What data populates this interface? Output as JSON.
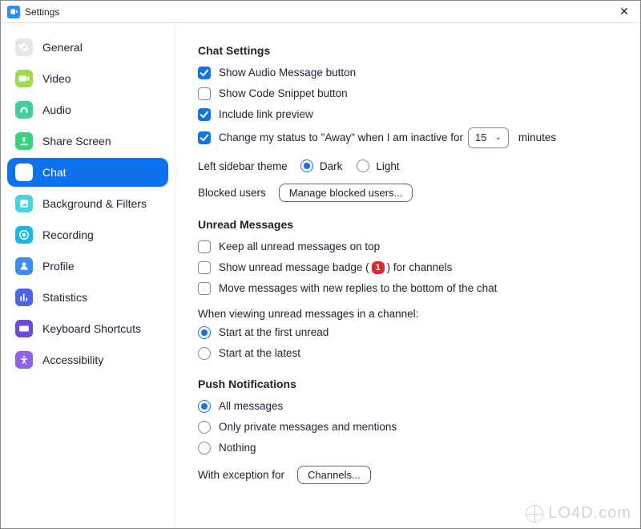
{
  "window": {
    "title": "Settings"
  },
  "sidebar": {
    "items": [
      {
        "label": "General",
        "color": "#E6E6E8",
        "icon": "gear",
        "active": false
      },
      {
        "label": "Video",
        "color": "#9BDB4D",
        "icon": "video",
        "active": false
      },
      {
        "label": "Audio",
        "color": "#3ED09C",
        "icon": "audio",
        "active": false
      },
      {
        "label": "Share Screen",
        "color": "#34D57A",
        "icon": "share",
        "active": false
      },
      {
        "label": "Chat",
        "color": "#0E72ED",
        "icon": "chat",
        "active": true
      },
      {
        "label": "Background & Filters",
        "color": "#48D1E0",
        "icon": "bgfilter",
        "active": false
      },
      {
        "label": "Recording",
        "color": "#18B7E6",
        "icon": "record",
        "active": false
      },
      {
        "label": "Profile",
        "color": "#3A8BF4",
        "icon": "profile",
        "active": false
      },
      {
        "label": "Statistics",
        "color": "#4B63E6",
        "icon": "stats",
        "active": false
      },
      {
        "label": "Keyboard Shortcuts",
        "color": "#6B4BD6",
        "icon": "keyboard",
        "active": false
      },
      {
        "label": "Accessibility",
        "color": "#8C63E8",
        "icon": "a11y",
        "active": false
      }
    ]
  },
  "chat_settings": {
    "title": "Chat Settings",
    "options": {
      "show_audio_msg": {
        "label": "Show Audio Message button",
        "checked": true
      },
      "show_code_snippet": {
        "label": "Show Code Snippet button",
        "checked": false
      },
      "link_preview": {
        "label": "Include link preview",
        "checked": true
      },
      "away_status": {
        "checked": true,
        "prefix": "Change my status to \"Away\" when I am inactive for",
        "value": "15",
        "suffix": "minutes"
      }
    },
    "left_sidebar_theme": {
      "label": "Left sidebar theme",
      "dark": "Dark",
      "light": "Light",
      "selected": "dark"
    },
    "blocked_users": {
      "label": "Blocked users",
      "button": "Manage blocked users..."
    }
  },
  "unread": {
    "title": "Unread Messages",
    "keep_on_top": {
      "label": "Keep all unread messages on top",
      "checked": false
    },
    "show_badge": {
      "prefix": "Show unread message badge (",
      "badge": "1",
      "suffix": ") for channels",
      "checked": false
    },
    "move_replies": {
      "label": "Move messages with new replies to the bottom of the chat",
      "checked": false
    },
    "viewing_prompt": "When viewing unread messages in a channel:",
    "start_at": {
      "first": "Start at the first unread",
      "latest": "Start at the latest",
      "selected": "first"
    }
  },
  "push": {
    "title": "Push Notifications",
    "options": {
      "all": "All messages",
      "private": "Only private messages and mentions",
      "nothing": "Nothing",
      "selected": "all"
    },
    "exception": {
      "label": "With exception for",
      "button": "Channels..."
    }
  },
  "watermark": "LO4D.com"
}
